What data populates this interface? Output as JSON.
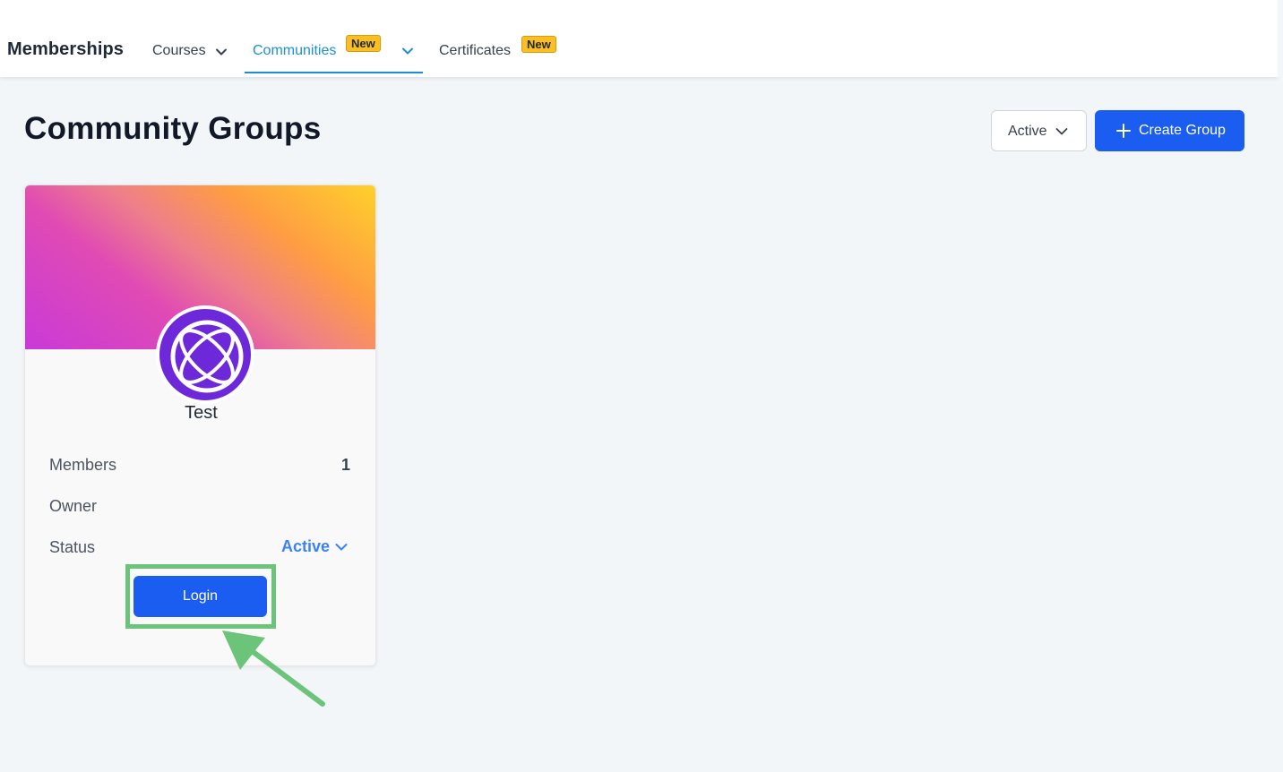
{
  "nav": {
    "brand": "Memberships",
    "items": [
      {
        "label": "Courses"
      },
      {
        "label": "Communities",
        "badge": "New",
        "active": true
      },
      {
        "label": "Certificates",
        "badge": "New"
      }
    ]
  },
  "header": {
    "title": "Community Groups",
    "filter_label": "Active",
    "create_label": "Create Group"
  },
  "group": {
    "name": "Test",
    "members_label": "Members",
    "members_count": "1",
    "owner_label": "Owner",
    "status_label": "Status",
    "status_value": "Active",
    "login_label": "Login"
  },
  "colors": {
    "accent": "#1a5df0",
    "active_tab": "#1d8fd0",
    "badge": "#fbbf24",
    "highlight": "#6cc47b",
    "avatar": "#6d28d9"
  },
  "icons": {
    "nav_dropdown": "chevron-down-icon",
    "create": "plus-icon",
    "avatar": "community-logo-icon",
    "annotation": "arrow-pointer-icon"
  }
}
